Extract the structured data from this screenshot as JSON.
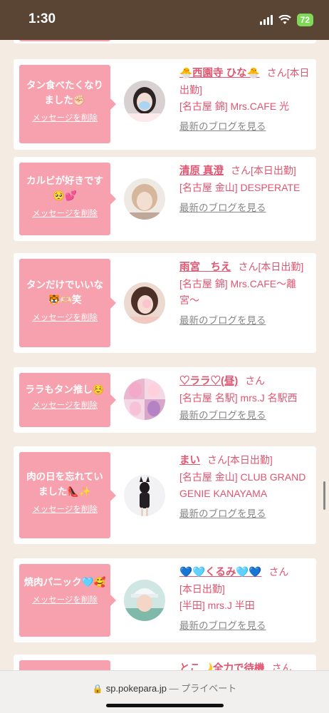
{
  "status": {
    "time": "1:30",
    "battery": "72"
  },
  "cards": [
    {
      "message": "タン食べたくなりました✊🏻",
      "delete": "メッセージを削除",
      "name": "🐣西園寺 ひな🐣",
      "san": "さん",
      "lines": [
        "[本日出勤]",
        "[名古屋 錦] Mrs.CAFE 光"
      ],
      "blog": "最新のブログを見る"
    },
    {
      "message": "カルビが好きです🥺💕",
      "delete": "メッセージを削除",
      "name": "清原 真澄",
      "san": "さん",
      "lines": [
        "[本日出勤]",
        "[名古屋 金山] DESPERATE"
      ],
      "blog": "最新のブログを見る"
    },
    {
      "message": "タンだけでいいな🐯🫶🏻笑",
      "delete": "メッセージを削除",
      "name": "雨宮　ちえ",
      "san": "さん",
      "lines": [
        "[本日出勤]",
        "[名古屋 錦] Mrs.CAFE〜離宮〜"
      ],
      "blog": "最新のブログを見る"
    },
    {
      "message": "ララもタン推し☺️",
      "delete": "メッセージを削除",
      "name": "♡ララ♡(昼)",
      "san": "さん",
      "lines": [
        "[名古屋 名駅] mrs.J 名駅西"
      ],
      "blog": "最新のブログを見る"
    },
    {
      "message": "肉の日を忘れていました👠✨",
      "delete": "メッセージを削除",
      "name": "まい",
      "san": "さん",
      "lines": [
        "[本日出勤]",
        "[名古屋 金山] CLUB GRAND GENIE KANAYAMA"
      ],
      "blog": "最新のブログを見る"
    },
    {
      "message": "焼肉パニック🩵🥰",
      "delete": "メッセージを削除",
      "name": "💙🩵くるみ🩵💙",
      "san": "さん",
      "lines": [
        "[本日出勤]",
        "[半田] mrs.J 半田"
      ],
      "blog": "最新のブログを見る"
    },
    {
      "message": "",
      "delete": "",
      "name": "とこ🌙全力で待機",
      "san": "さん",
      "lines": [],
      "blog": ""
    }
  ],
  "browser": {
    "url": "sp.pokepara.jp",
    "separator": "—",
    "mode": "プライベート"
  }
}
